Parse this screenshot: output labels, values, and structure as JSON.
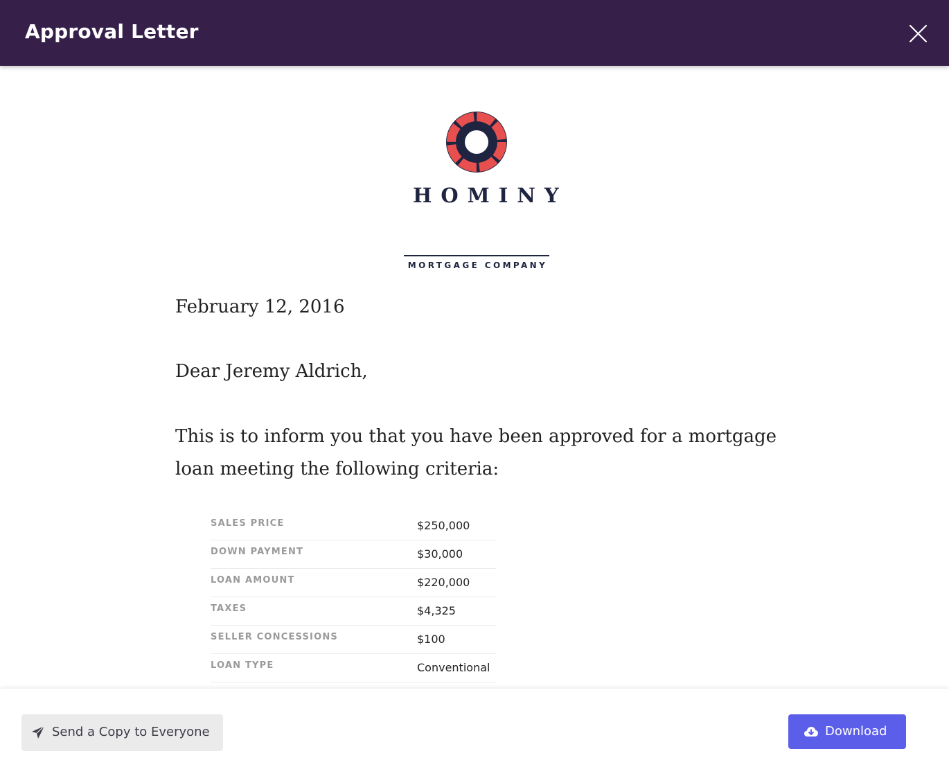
{
  "window": {
    "title": "Approval Letter",
    "close_icon": "close-icon"
  },
  "brand": {
    "name": "HOMINY",
    "subtitle": "MORTGAGE COMPANY",
    "logo_icon": "lifebuoy-logo-icon",
    "accent_color": "#e8504f",
    "dark_color": "#1f2440"
  },
  "letter": {
    "date": "February 12, 2016",
    "greeting": "Dear Jeremy Aldrich,",
    "body": "This is to inform you that you have been approved for a mortgage loan meeting the following criteria:"
  },
  "criteria": [
    {
      "label": "SALES PRICE",
      "value": "$250,000"
    },
    {
      "label": "DOWN PAYMENT",
      "value": "$30,000"
    },
    {
      "label": "LOAN AMOUNT",
      "value": "$220,000"
    },
    {
      "label": "TAXES",
      "value": "$4,325"
    },
    {
      "label": "SELLER CONCESSIONS",
      "value": "$100"
    },
    {
      "label": "LOAN TYPE",
      "value": "Conventional"
    }
  ],
  "footer": {
    "send_label": "Send a Copy to Everyone",
    "send_icon": "paper-plane-icon",
    "download_label": "Download",
    "download_icon": "cloud-download-icon"
  },
  "colors": {
    "header_bg": "#36204a",
    "primary_button": "#5b5ee8",
    "secondary_button": "#ebebeb"
  }
}
